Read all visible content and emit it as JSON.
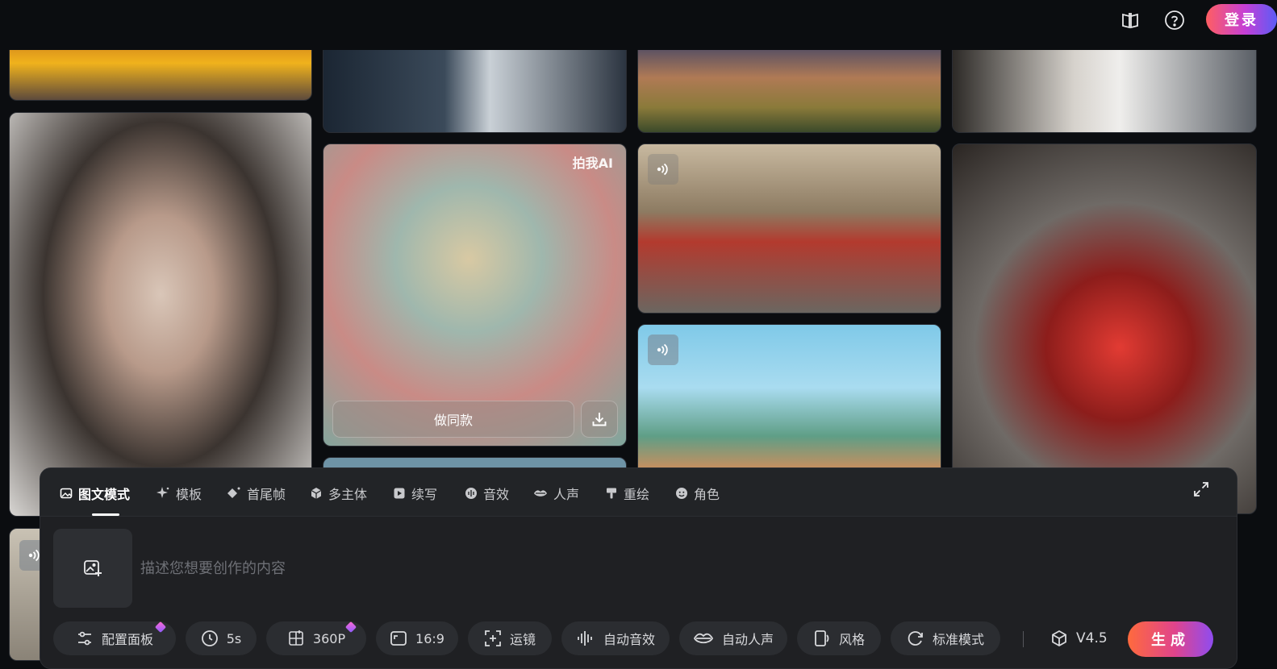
{
  "header": {
    "login_label": "登录"
  },
  "gallery": {
    "watermark": "拍我AI",
    "hover_actions": {
      "make_same_label": "做同款"
    }
  },
  "composer": {
    "tabs": [
      {
        "label": "图文模式",
        "icon": "image-icon",
        "active": true
      },
      {
        "label": "模板",
        "icon": "sparkle-icon"
      },
      {
        "label": "首尾帧",
        "icon": "keyframe-icon"
      },
      {
        "label": "多主体",
        "icon": "cube-icon"
      },
      {
        "label": "续写",
        "icon": "continue-icon"
      },
      {
        "label": "音效",
        "icon": "sound-effect-icon"
      },
      {
        "label": "人声",
        "icon": "lips-icon"
      },
      {
        "label": "重绘",
        "icon": "brush-icon"
      },
      {
        "label": "角色",
        "icon": "face-icon"
      }
    ],
    "prompt_placeholder": "描述您想要创作的内容",
    "options": {
      "config_panel": "配置面板",
      "duration": "5s",
      "resolution": "360P",
      "aspect_ratio": "16:9",
      "camera": "运镜",
      "auto_sound": "自动音效",
      "auto_voice": "自动人声",
      "style": "风格",
      "mode": "标准模式"
    },
    "model_version": "V4.5",
    "generate_label": "生成"
  },
  "colors": {
    "accent_start": "#ff6a3d",
    "accent_end": "#8f4cf0",
    "panel_bg": "#1f2023"
  }
}
